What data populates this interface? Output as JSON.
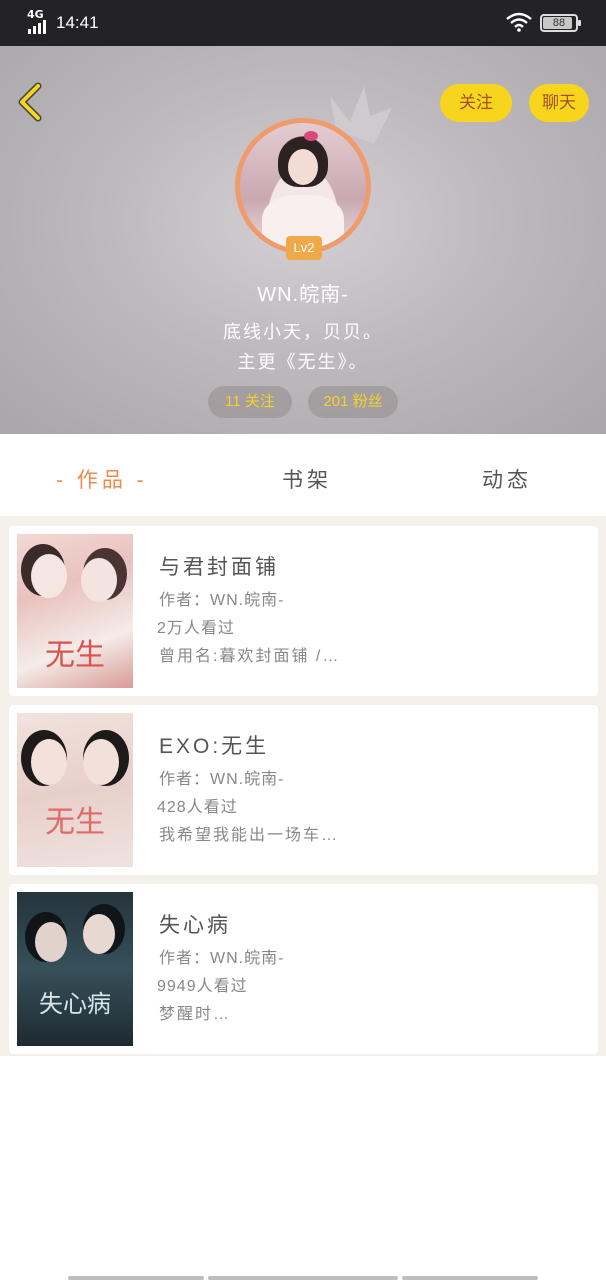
{
  "status_bar": {
    "network": "4G",
    "time": "14:41",
    "battery": "88"
  },
  "header": {
    "follow_label": "关注",
    "chat_label": "聊天",
    "level": "Lv2",
    "username": "WN.皖南-",
    "bio_line1": "底线小天，贝贝。",
    "bio_line2": "主更《无生》。",
    "follow_count": "11 关注",
    "fans_count": "201 粉丝"
  },
  "tabs": [
    {
      "label": "- 作品 -"
    },
    {
      "label": "书架"
    },
    {
      "label": "动态"
    }
  ],
  "books": [
    {
      "title": "与君封面铺",
      "author": "作者：WN.皖南-",
      "views": "2万人看过",
      "desc": "曾用名:暮欢封面铺 /…",
      "cover_text": "无生"
    },
    {
      "title": "EXO:无生",
      "author": "作者：WN.皖南-",
      "views": "428人看过",
      "desc": "我希望我能出一场车…",
      "cover_text": "无生"
    },
    {
      "title": "失心病",
      "author": "作者：WN.皖南-",
      "views": "9949人看过",
      "desc": "梦醒时…",
      "cover_text": "失心病"
    }
  ],
  "colors": {
    "accent": "#f08a4b",
    "button_yellow": "#f7d51d",
    "stat_yellow": "#f4d22c"
  }
}
